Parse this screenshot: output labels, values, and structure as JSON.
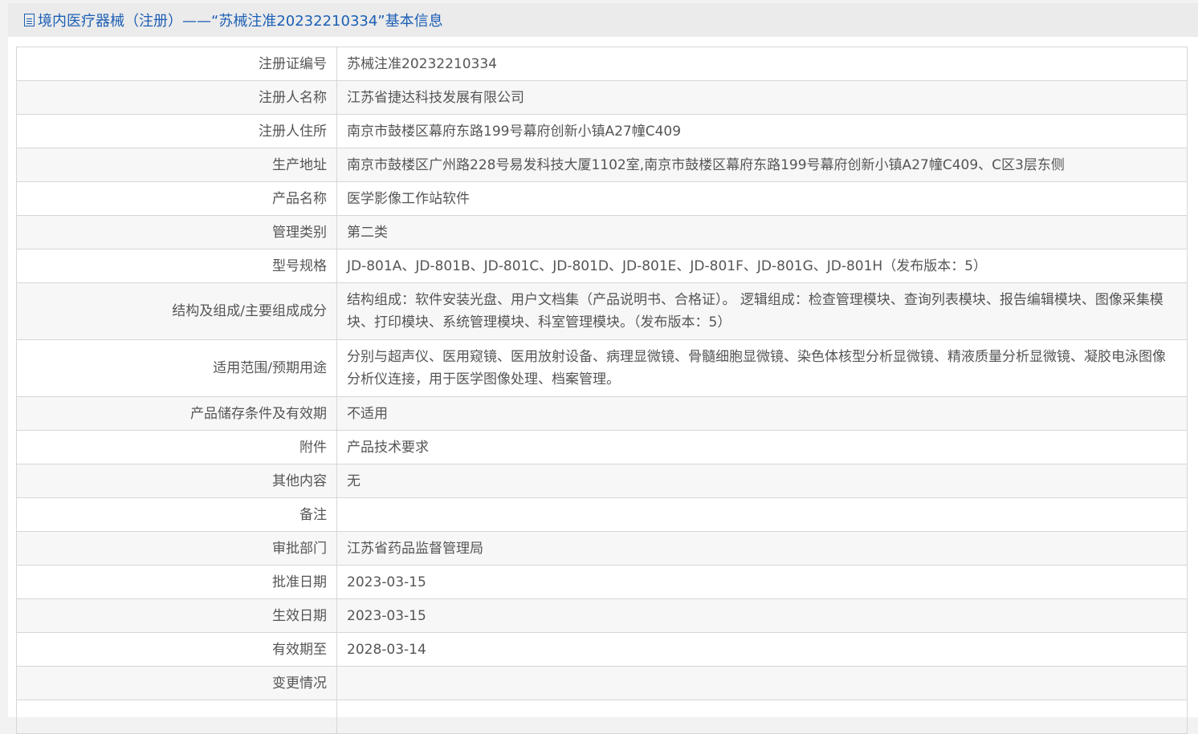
{
  "header": {
    "title": "境内医疗器械（注册）——“苏械注准20232210334”基本信息"
  },
  "rows": [
    {
      "label": "注册证编号",
      "value": "苏械注准20232210334"
    },
    {
      "label": "注册人名称",
      "value": "江苏省捷达科技发展有限公司"
    },
    {
      "label": "注册人住所",
      "value": "南京市鼓楼区幕府东路199号幕府创新小镇A27幢C409"
    },
    {
      "label": "生产地址",
      "value": "南京市鼓楼区广州路228号易发科技大厦1102室,南京市鼓楼区幕府东路199号幕府创新小镇A27幢C409、C区3层东侧"
    },
    {
      "label": "产品名称",
      "value": "医学影像工作站软件"
    },
    {
      "label": "管理类别",
      "value": "第二类"
    },
    {
      "label": "型号规格",
      "value": "JD-801A、JD-801B、JD-801C、JD-801D、JD-801E、JD-801F、JD-801G、JD-801H（发布版本：5）"
    },
    {
      "label": "结构及组成/主要组成成分",
      "value": "结构组成：软件安装光盘、用户文档集（产品说明书、合格证）。 逻辑组成：检查管理模块、查询列表模块、报告编辑模块、图像采集模块、打印模块、系统管理模块、科室管理模块。（发布版本：5）"
    },
    {
      "label": "适用范围/预期用途",
      "value": "分别与超声仪、医用窥镜、医用放射设备、病理显微镜、骨髓细胞显微镜、染色体核型分析显微镜、精液质量分析显微镜、凝胶电泳图像分析仪连接，用于医学图像处理、档案管理。"
    },
    {
      "label": "产品储存条件及有效期",
      "value": "不适用"
    },
    {
      "label": "附件",
      "value": "产品技术要求"
    },
    {
      "label": "其他内容",
      "value": "无"
    },
    {
      "label": "备注",
      "value": ""
    },
    {
      "label": "审批部门",
      "value": "江苏省药品监督管理局"
    },
    {
      "label": "批准日期",
      "value": "2023-03-15"
    },
    {
      "label": "生效日期",
      "value": "2023-03-15"
    },
    {
      "label": "有效期至",
      "value": "2028-03-14"
    },
    {
      "label": "变更情况",
      "value": ""
    },
    {
      "label": "",
      "value": ""
    }
  ]
}
